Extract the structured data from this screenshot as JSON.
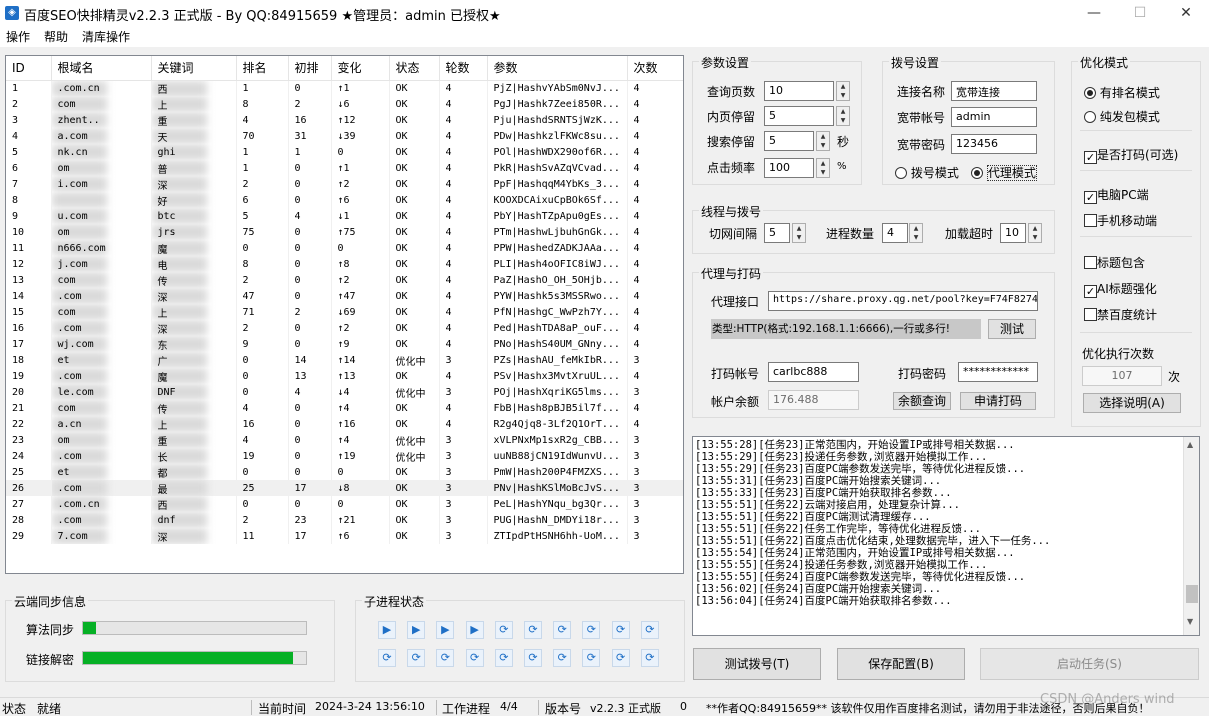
{
  "window": {
    "title": "百度SEO快排精灵v2.2.3 正式版 - By QQ:84915659 ★管理员：admin 已授权★",
    "minimize": "—",
    "maximize": "☐",
    "close": "✕"
  },
  "menu": [
    "操作",
    "帮助",
    "清库操作"
  ],
  "table": {
    "columns": [
      "ID",
      "根域名",
      "关键词",
      "排名",
      "初排",
      "变化",
      "状态",
      "轮数",
      "参数",
      "次数"
    ],
    "rows": [
      [
        "1",
        ".com.cn",
        "西",
        "1",
        "0",
        "↑1",
        "OK",
        "4",
        "PjZ|HashvYAbSm0NvJ...",
        "4"
      ],
      [
        "2",
        "com",
        "上",
        "8",
        "2",
        "↓6",
        "OK",
        "4",
        "PgJ|Hashk7Zeei850R...",
        "4"
      ],
      [
        "3",
        "zhent..",
        "重",
        "4",
        "16",
        "↑12",
        "OK",
        "4",
        "Pju|HashdSRNTSjWzK...",
        "4"
      ],
      [
        "4",
        "a.com",
        "天",
        "70",
        "31",
        "↓39",
        "OK",
        "4",
        "PDw|HashkzlFKWc8su...",
        "4"
      ],
      [
        "5",
        "nk.cn",
        "ghi",
        "1",
        "1",
        "0",
        "OK",
        "4",
        "POl|HashWDX290of6R...",
        "4"
      ],
      [
        "6",
        "om",
        "普",
        "1",
        "0",
        "↑1",
        "OK",
        "4",
        "PkR|HashSvAZqVCvad...",
        "4"
      ],
      [
        "7",
        "i.com",
        "深",
        "2",
        "0",
        "↑2",
        "OK",
        "4",
        "PpF|HashqqM4YbKs_3...",
        "4"
      ],
      [
        "8",
        "",
        "好",
        "6",
        "0",
        "↑6",
        "OK",
        "4",
        "KOOXDCAixuCpBOk6Sf...",
        "4"
      ],
      [
        "9",
        "u.com",
        "btc",
        "5",
        "4",
        "↓1",
        "OK",
        "4",
        "PbY|HashTZpApu0gEs...",
        "4"
      ],
      [
        "10",
        "om",
        "jrs",
        "75",
        "0",
        "↑75",
        "OK",
        "4",
        "PTm|HashwLjbuhGnGk...",
        "4"
      ],
      [
        "11",
        "n666.com",
        "魔",
        "0",
        "0",
        "0",
        "OK",
        "4",
        "PPW|HashedZADKJAAa...",
        "4"
      ],
      [
        "12",
        "j.com",
        "电",
        "8",
        "0",
        "↑8",
        "OK",
        "4",
        "PLI|Hash4oOFIC8iWJ...",
        "4"
      ],
      [
        "13",
        "com",
        "传",
        "2",
        "0",
        "↑2",
        "OK",
        "4",
        "PaZ|HashO_OH_5OHjb...",
        "4"
      ],
      [
        "14",
        ".com",
        "深",
        "47",
        "0",
        "↑47",
        "OK",
        "4",
        "PYW|Hashk5s3MSSRwo...",
        "4"
      ],
      [
        "15",
        "com",
        "上",
        "71",
        "2",
        "↓69",
        "OK",
        "4",
        "PfN|HashgC_WwPzh7Y...",
        "4"
      ],
      [
        "16",
        ".com",
        "深",
        "2",
        "0",
        "↑2",
        "OK",
        "4",
        "Ped|HashTDA8aP_ouF...",
        "4"
      ],
      [
        "17",
        "wj.com",
        "东",
        "9",
        "0",
        "↑9",
        "OK",
        "4",
        "PNo|HashS40UM_GNny...",
        "4"
      ],
      [
        "18",
        "et",
        "广",
        "0",
        "14",
        "↑14",
        "优化中",
        "3",
        "PZs|HashAU_feMkIbR...",
        "3"
      ],
      [
        "19",
        ".com",
        "魔",
        "0",
        "13",
        "↑13",
        "OK",
        "4",
        "PSv|Hashx3MvtXruUL...",
        "4"
      ],
      [
        "20",
        "le.com",
        "DNF",
        "0",
        "4",
        "↓4",
        "优化中",
        "3",
        "POj|HashXqriKG5lms...",
        "3"
      ],
      [
        "21",
        "com",
        "传",
        "4",
        "0",
        "↑4",
        "OK",
        "4",
        "FbB|Hash8pBJB5il7f...",
        "4"
      ],
      [
        "22",
        "a.cn",
        "上",
        "16",
        "0",
        "↑16",
        "OK",
        "4",
        "R2g4Qjq8-3Lf2Q1OrT...",
        "4"
      ],
      [
        "23",
        "om",
        "重",
        "4",
        "0",
        "↑4",
        "优化中",
        "3",
        "xVLPNxMp1sxR2g_CBB...",
        "3"
      ],
      [
        "24",
        ".com",
        "长",
        "19",
        "0",
        "↑19",
        "优化中",
        "3",
        "uuNB88jCN19IdWunvU...",
        "3"
      ],
      [
        "25",
        "et",
        "都",
        "0",
        "0",
        "0",
        "OK",
        "3",
        "PmW|Hash200P4FMZXS...",
        "3"
      ],
      [
        "26",
        ".com",
        "最",
        "25",
        "17",
        "↓8",
        "OK",
        "3",
        "PNv|HashKSlMoBcJvS...",
        "3"
      ],
      [
        "27",
        ".com.cn",
        "西",
        "0",
        "0",
        "0",
        "OK",
        "3",
        "PeL|HashYNqu_bg3Qr...",
        "3"
      ],
      [
        "28",
        ".com",
        "dnf",
        "2",
        "23",
        "↑21",
        "OK",
        "3",
        "PUG|HashN_DMDYi18r...",
        "3"
      ],
      [
        "29",
        "7.com",
        "深",
        "11",
        "17",
        "↑6",
        "OK",
        "3",
        "ZTIpdPtHSNH6hh-UoM...",
        "3"
      ]
    ],
    "selected_row": 25
  },
  "params": {
    "title": "参数设置",
    "query_pages_label": "查询页数",
    "query_pages": "10",
    "inner_stay_label": "内页停留",
    "inner_stay": "5",
    "search_stay_label": "搜索停留",
    "search_stay": "5",
    "search_stay_unit": "秒",
    "click_freq_label": "点击频率",
    "click_freq": "100",
    "click_freq_unit": "%"
  },
  "dial": {
    "title": "拨号设置",
    "conn_name_label": "连接名称",
    "conn_name": "宽带连接",
    "account_label": "宽带帐号",
    "account": "admin",
    "password_label": "宽带密码",
    "password": "123456",
    "mode_dial": "拨号模式",
    "mode_proxy": "代理模式"
  },
  "optimize": {
    "title": "优化模式",
    "mode_rank": "有排名模式",
    "mode_pure": "纯发包模式",
    "captcha": "是否打码(可选)",
    "pc": "电脑PC端",
    "mobile": "手机移动端",
    "title_contain": "标题包含",
    "ai_title": "AI标题强化",
    "no_stats": "禁百度统计",
    "exec_count_label": "优化执行次数",
    "exec_count": "107",
    "exec_count_unit": "次",
    "help_button": "选择说明(A)",
    "check_mark": "✓"
  },
  "thread": {
    "title": "线程与拨号",
    "switch_label": "切网间隔",
    "switch_value": "5",
    "proc_label": "进程数量",
    "proc_value": "4",
    "timeout_label": "加载超时",
    "timeout_value": "10"
  },
  "proxy": {
    "title": "代理与打码",
    "api_label": "代理接口",
    "api_value": "https://share.proxy.qg.net/pool?key=F74F8274",
    "type_hint": "类型:HTTP(格式:192.168.1.1:6666),一行或多行!",
    "test_button": "测试",
    "captcha_account_label": "打码帐号",
    "captcha_account": "carlbc888",
    "captcha_password_label": "打码密码",
    "captcha_password": "************",
    "balance_label": "帐户余额",
    "balance": "176.488",
    "balance_button": "余额查询",
    "apply_button": "申请打码"
  },
  "log": [
    "[13:55:28][任务23]正常范围内，开始设置IP或排号相关数据...",
    "[13:55:29][任务23]投递任务参数,浏览器开始模拟工作...",
    "[13:55:29][任务23]百度PC端参数发送完毕，等待优化进程反馈...",
    "[13:55:31][任务23]百度PC端开始搜索关键词...",
    "[13:55:33][任务23]百度PC端开始获取排名参数...",
    "[13:55:51][任务22]云端对接启用，处理复杂计算...",
    "[13:55:51][任务22]百度PC端测试清理缓存...",
    "[13:55:51][任务22]任务工作完毕，等待优化进程反馈...",
    "[13:55:51][任务22]百度点击优化结束,处理数据完毕，进入下一任务...",
    "[13:55:54][任务24]正常范围内，开始设置IP或排号相关数据...",
    "[13:55:55][任务24]投递任务参数,浏览器开始模拟工作...",
    "[13:55:55][任务24]百度PC端参数发送完毕，等待优化进程反馈...",
    "[13:56:02][任务24]百度PC端开始搜索关键词...",
    "[13:56:04][任务24]百度PC端开始获取排名参数..."
  ],
  "cloud": {
    "title": "云端同步信息",
    "algo_label": "算法同步",
    "algo_progress": 0.06,
    "link_label": "链接解密",
    "link_progress": 0.94
  },
  "subprocess": {
    "title": "子进程状态",
    "row1": [
      "▶",
      "▶",
      "▶",
      "▶",
      "⟳",
      "⟳",
      "⟳",
      "⟳",
      "⟳",
      "⟳"
    ],
    "row2": [
      "⟳",
      "⟳",
      "⟳",
      "⟳",
      "⟳",
      "⟳",
      "⟳",
      "⟳",
      "⟳",
      "⟳"
    ]
  },
  "actions": {
    "test_dial": "测试拨号(T)",
    "save": "保存配置(B)",
    "start": "启动任务(S)"
  },
  "status": {
    "state_label": "状态",
    "state": "就绪",
    "time_label": "当前时间",
    "time": "2024-3-24 13:56:10",
    "proc_label": "工作进程",
    "proc": "4/4",
    "version_label": "版本号",
    "version": "v2.2.3 正式版",
    "version_num": "0",
    "notice": "**作者QQ:84915659** 该软件仅用作百度排名测试，请勿用于非法途径，否则后果自负！",
    "watermark": "CSDN @Anders wind"
  }
}
